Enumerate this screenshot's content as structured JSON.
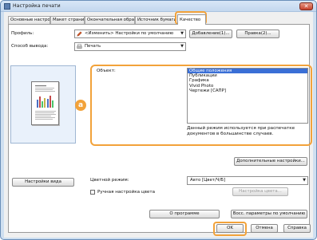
{
  "window": {
    "title": "Настройка печати",
    "close_glyph": "✕"
  },
  "tabs": [
    {
      "label": "Основные настройки"
    },
    {
      "label": "Макет страницы"
    },
    {
      "label": "Окончательная обработка"
    },
    {
      "label": "Источник бумаги"
    },
    {
      "label": "Качество"
    }
  ],
  "profile": {
    "label": "Профиль:",
    "value": "<Изменить> Настройки по умолчанию",
    "add_button": "Добавление(1)...",
    "edit_button": "Правка(2)..."
  },
  "output": {
    "label": "Способ вывода:",
    "value": "Печать"
  },
  "objective": {
    "label": "Объект:",
    "items": [
      {
        "label": "Общие положения",
        "selected": true
      },
      {
        "label": "Публикации",
        "selected": false
      },
      {
        "label": "Графика",
        "selected": false
      },
      {
        "label": "Vivid Photo",
        "selected": false
      },
      {
        "label": "Чертежи [САПР]",
        "selected": false
      }
    ],
    "description": "Данный режим используется при распечатке документов в большинстве случаев.",
    "badge": "a"
  },
  "advanced_button": "Дополнительные настройки...",
  "view_settings_button": "Настройки вида",
  "color_mode": {
    "label": "Цветной режим:",
    "value": "Авто [Цвет/Ч/Б]"
  },
  "manual_color": {
    "label": "Ручная настройка цвета",
    "checked": false,
    "button": "Настройка цвета..."
  },
  "about_button": "О программе",
  "restore_button": "Восс. параметры по умолчанию",
  "footer": {
    "ok": "OK",
    "cancel": "Отмена",
    "help": "Справка"
  },
  "colors": {
    "highlight": "#f2a23a",
    "selection": "#3a6fd6"
  }
}
